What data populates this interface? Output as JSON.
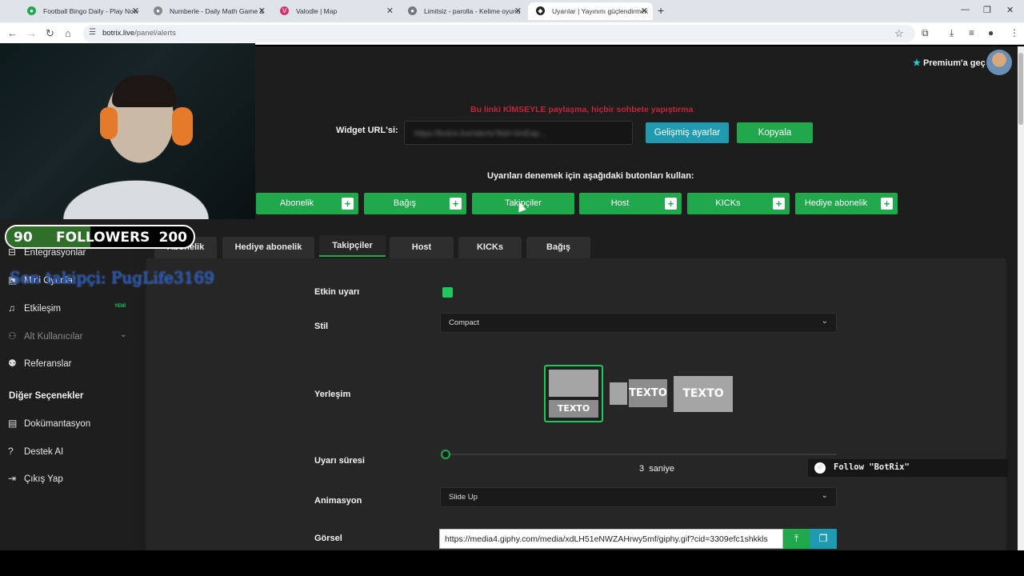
{
  "browser": {
    "tabs": [
      {
        "title": "Football Bingo Daily - Play Now",
        "icon": "globe-icon",
        "color": "#22a84c"
      },
      {
        "title": "Numberle - Daily Math Game &",
        "icon": "globe-icon",
        "color": "#888888"
      },
      {
        "title": "Valodle | Map",
        "icon": "globe-icon",
        "color": "#d6336c"
      },
      {
        "title": "Limitsiz - parolla - Kelime oyunu",
        "icon": "globe-icon",
        "color": "#777777"
      },
      {
        "title": "Uyarılar | Yayınını güçlendirmek",
        "icon": "globe-icon",
        "color": "#222222"
      }
    ],
    "url_host": "botrix.live",
    "url_path": "/panel/alerts"
  },
  "header": {
    "premium": "Premium'a geç"
  },
  "widget": {
    "warning": "Bu linki KİMSEYLE paylaşma, hiçbir sohbete yapıştırma",
    "url_label": "Widget URL'si:",
    "url_value": "https://botrix.live/alerts?bid=0mEap…",
    "advanced_button": "Gelişmiş ayarlar",
    "copy_button": "Kopyala"
  },
  "test": {
    "label": "Uyarıları denemek için aşağıdaki butonları kullan:",
    "buttons": [
      "Abonelik",
      "Bağış",
      "Takipçiler",
      "Host",
      "KICKs",
      "Hediye abonelik"
    ]
  },
  "tabs": [
    {
      "label": "Abonelik"
    },
    {
      "label": "Hediye abonelik"
    },
    {
      "label": "Takipçiler",
      "active": true
    },
    {
      "label": "Host"
    },
    {
      "label": "KICKs"
    },
    {
      "label": "Bağış"
    }
  ],
  "form": {
    "active_label": "Etkin uyarı",
    "active_checked": true,
    "style_label": "Stil",
    "style_value": "Compact",
    "layout_label": "Yerleşim",
    "layout_text": "TEXTO",
    "duration_label": "Uyarı süresi",
    "duration_value": "3",
    "duration_unit": "saniye",
    "duration_fraction": 0.0,
    "animation_label": "Animasyon",
    "animation_value": "Slide Up",
    "image_label": "Görsel",
    "image_url": "https://media4.giphy.com/media/xdLH51eNWZAHrwy5mf/giphy.gif?cid=3309efc1shkkls"
  },
  "sidebar": {
    "items": [
      {
        "label": "Entegrasyonlar",
        "icon": "plug-icon"
      },
      {
        "label": "Mini Oyunlar",
        "icon": "gamepad-icon"
      },
      {
        "label": "Etkileşim",
        "icon": "music-icon",
        "badge": "YENİ"
      },
      {
        "label": "Alt Kullanıcılar",
        "icon": "users-icon"
      },
      {
        "label": "Referanslar",
        "icon": "people-icon"
      }
    ],
    "other_heading": "Diğer Seçenekler",
    "other_items": [
      {
        "label": "Dokümantasyon",
        "icon": "doc-icon"
      },
      {
        "label": "Destek AI",
        "icon": "help-icon"
      },
      {
        "label": "Çıkış Yap",
        "icon": "logout-icon"
      }
    ]
  },
  "overlay": {
    "followers_current": "90",
    "followers_label": "FOLLOWERS",
    "followers_goal": "200",
    "followers_fraction": 0.45,
    "last_follower": "Son takipçi: PugLife3169",
    "follow_prompt": "Follow \"BotRix\""
  },
  "colors": {
    "green": "#22a84c",
    "teal": "#1f9ab0",
    "warning": "#c0263a"
  }
}
